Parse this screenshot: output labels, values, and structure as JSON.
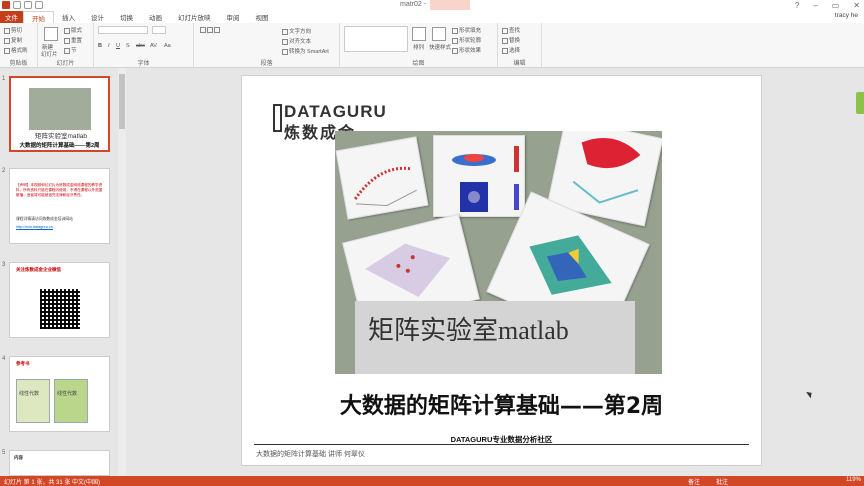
{
  "window": {
    "doc_title": "matr02 -",
    "controls": [
      "?",
      "–",
      "▭",
      "✕"
    ]
  },
  "tabs": [
    {
      "label": "文件"
    },
    {
      "label": "开始"
    },
    {
      "label": "插入"
    },
    {
      "label": "设计"
    },
    {
      "label": "切换"
    },
    {
      "label": "动画"
    },
    {
      "label": "幻灯片放映"
    },
    {
      "label": "审阅"
    },
    {
      "label": "视图"
    }
  ],
  "user": "tracy he",
  "ribbon": {
    "clipboard": {
      "label": "剪贴板",
      "cut": "剪切",
      "copy": "复制",
      "format": "格式刷"
    },
    "slides": {
      "label": "幻灯片",
      "new": "新建",
      "new2": "幻灯片",
      "layout": "版式",
      "reset": "重置",
      "section": "节"
    },
    "font": {
      "label": "字体",
      "bold": "B",
      "italic": "I",
      "underline": "U",
      "shadow": "S",
      "strike": "abc",
      "spacing": "AV",
      "case": "Aa"
    },
    "paragraph": {
      "label": "段落",
      "dir": "文字方向",
      "align": "对齐文本",
      "smart": "转换为 SmartArt"
    },
    "drawing": {
      "label": "绘图",
      "arrange": "排列",
      "quick": "快速样式",
      "fill": "形状填充",
      "outline": "形状轮廓",
      "effect": "形状效果"
    },
    "editing": {
      "label": "编辑",
      "find": "查找",
      "replace": "替换",
      "select": "选择"
    }
  },
  "thumbs": [
    {
      "num": "1",
      "title": "矩阵实验室matlab",
      "subtitle": "大数据的矩阵计算基础——第2周"
    },
    {
      "num": "2",
      "line1": "【声明】本视频和幻灯片为炼数成金网络课程的教学资料，所有资料只能在课程内使用，不得在课程以外范围散播，违者将可能被追究法律和经济责任。",
      "line2": "课程详情请访问炼数成金培训网站",
      "link": "http://edu.dataguru.cn"
    },
    {
      "num": "3",
      "title": "关注炼数成金企业微信"
    },
    {
      "num": "4",
      "title": "参考书",
      "book1": "线性代数",
      "book2": "线性代数"
    },
    {
      "num": "5",
      "title": "内容"
    }
  ],
  "slide": {
    "logo_en": "DATAGURU",
    "logo_cn": "炼数成金",
    "matlab_text": "矩阵实验室matlab",
    "title": "大数据的矩阵计算基础——第2周",
    "brand": "DATAGURU专业数据分析社区",
    "note": "大数据的矩阵计算基础 讲师 何翠仪"
  },
  "status": {
    "slide_count": "幻灯片 第 1 张，共 31 张",
    "lang": "中文(中国)",
    "notes": "备注",
    "comments": "批注",
    "zoom": "119%"
  }
}
